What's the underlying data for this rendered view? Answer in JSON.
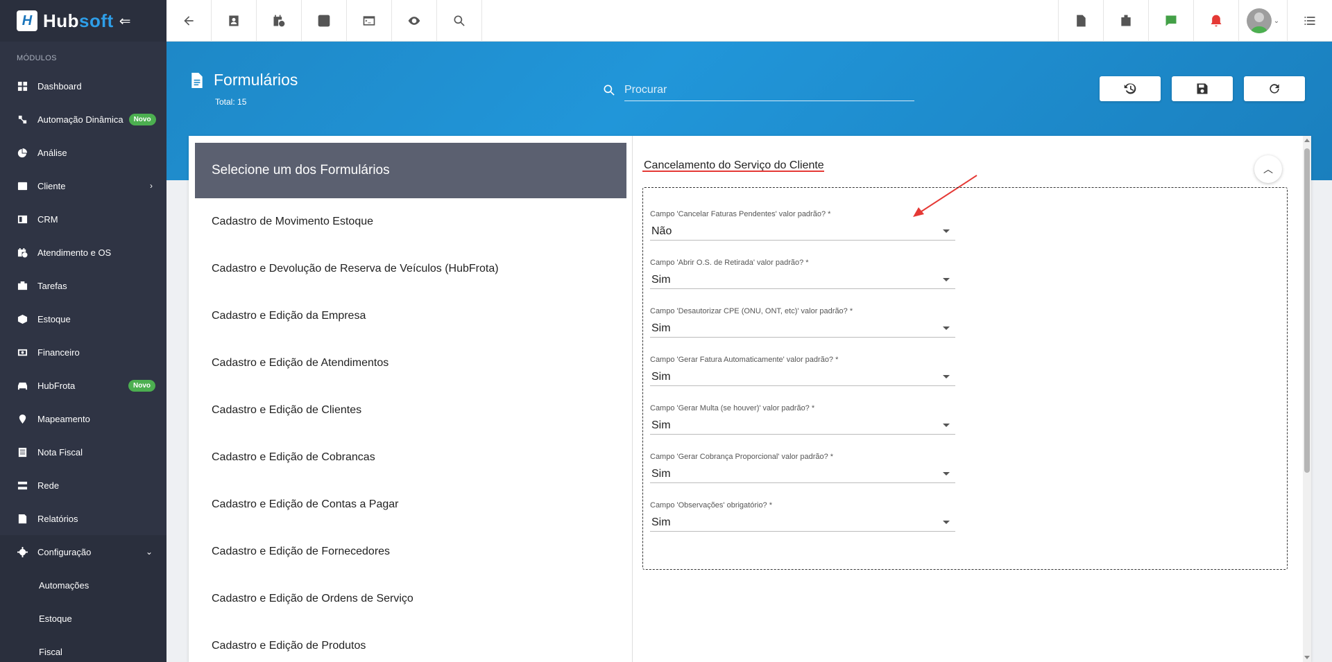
{
  "brand": {
    "name_part1": "Hub",
    "name_part2": "soft",
    "logo_letter": "H"
  },
  "sidebar": {
    "section_label": "MÓDULOS",
    "items": [
      {
        "label": "Dashboard",
        "icon": "dashboard-icon"
      },
      {
        "label": "Automação Dinâmica",
        "icon": "automation-icon",
        "badge": "Novo"
      },
      {
        "label": "Análise",
        "icon": "pie-chart-icon"
      },
      {
        "label": "Cliente",
        "icon": "client-card-icon",
        "chevron": "›"
      },
      {
        "label": "CRM",
        "icon": "crm-icon"
      },
      {
        "label": "Atendimento e OS",
        "icon": "calendar-clock-icon"
      },
      {
        "label": "Tarefas",
        "icon": "tasks-icon"
      },
      {
        "label": "Estoque",
        "icon": "box-icon"
      },
      {
        "label": "Financeiro",
        "icon": "money-icon"
      },
      {
        "label": "HubFrota",
        "icon": "car-icon",
        "badge": "Novo"
      },
      {
        "label": "Mapeamento",
        "icon": "map-pin-icon"
      },
      {
        "label": "Nota Fiscal",
        "icon": "invoice-icon"
      },
      {
        "label": "Rede",
        "icon": "network-icon"
      },
      {
        "label": "Relatórios",
        "icon": "report-icon"
      },
      {
        "label": "Configuração",
        "icon": "gear-icon",
        "chevron": "⌄"
      }
    ],
    "sub_items": [
      {
        "label": "Automações"
      },
      {
        "label": "Estoque"
      },
      {
        "label": "Fiscal"
      }
    ]
  },
  "header": {
    "title": "Formulários",
    "total": "Total: 15",
    "search_placeholder": "Procurar"
  },
  "forms_list": {
    "header": "Selecione um dos Formulários",
    "items": [
      "Cadastro de Movimento Estoque",
      "Cadastro e Devolução de Reserva de Veículos (HubFrota)",
      "Cadastro e Edição da Empresa",
      "Cadastro e Edição de Atendimentos",
      "Cadastro e Edição de Clientes",
      "Cadastro e Edição de Cobrancas",
      "Cadastro e Edição de Contas a Pagar",
      "Cadastro e Edição de Fornecedores",
      "Cadastro e Edição de Ordens de Serviço",
      "Cadastro e Edição de Produtos"
    ]
  },
  "detail": {
    "section_title": "Cancelamento do Serviço do Cliente",
    "fields": [
      {
        "label": "Campo 'Cancelar Faturas Pendentes' valor padrão? *",
        "value": "Não"
      },
      {
        "label": "Campo 'Abrir O.S. de Retirada' valor padrão? *",
        "value": "Sim"
      },
      {
        "label": "Campo 'Desautorizar CPE (ONU, ONT, etc)' valor padrão? *",
        "value": "Sim"
      },
      {
        "label": "Campo 'Gerar Fatura Automaticamente' valor padrão? *",
        "value": "Sim"
      },
      {
        "label": "Campo 'Gerar Multa (se houver)' valor padrão? *",
        "value": "Sim"
      },
      {
        "label": "Campo 'Gerar Cobrança Proporcional' valor padrão? *",
        "value": "Sim"
      },
      {
        "label": "Campo 'Observações' obrigatório? *",
        "value": "Sim"
      }
    ]
  },
  "colors": {
    "sidebar_bg": "#2f3444",
    "header_blue": "#1e88c7",
    "badge_green": "#4caf50",
    "annotation_red": "#e53935",
    "list_header_bg": "#5b6070"
  }
}
